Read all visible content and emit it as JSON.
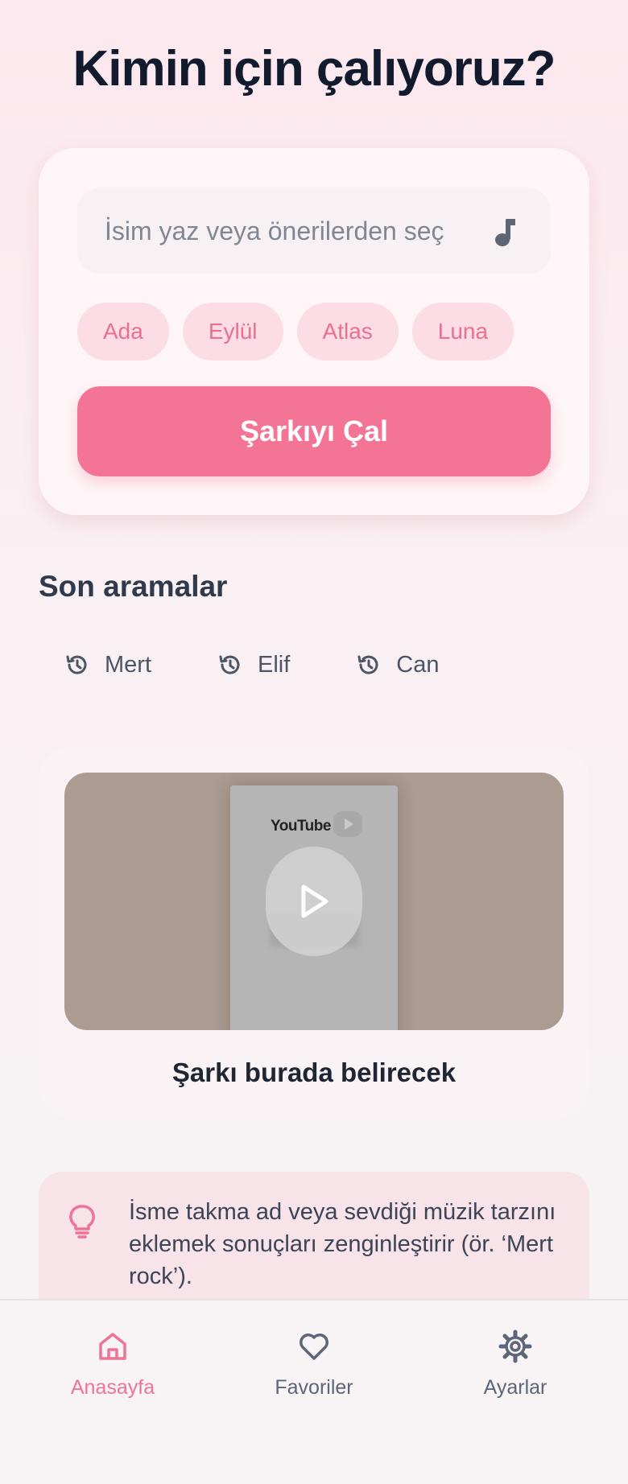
{
  "title": "Kimin için çalıyoruz?",
  "search": {
    "placeholder": "İsim yaz veya önerilerden seç",
    "icon": "music-note-icon"
  },
  "suggestions": [
    "Ada",
    "Eylül",
    "Atlas",
    "Luna"
  ],
  "play_button_label": "Şarkıyı Çal",
  "recent": {
    "title": "Son aramalar",
    "items": [
      "Mert",
      "Elif",
      "Can"
    ],
    "icon": "history-icon"
  },
  "player": {
    "thumbnail_text": "YouTube",
    "caption": "Şarkı burada belirecek"
  },
  "tip": {
    "icon": "lightbulb-icon",
    "text": "İsme takma ad veya sevdiği müzik tarzını eklemek sonuçları zenginleştirir (ör. ‘Mert rock’)."
  },
  "nav": {
    "items": [
      {
        "label": "Anasayfa",
        "icon": "home-icon",
        "active": true
      },
      {
        "label": "Favoriler",
        "icon": "heart-icon",
        "active": false
      },
      {
        "label": "Ayarlar",
        "icon": "gear-icon",
        "active": false
      }
    ]
  },
  "colors": {
    "accent": "#f47495",
    "chip_bg": "#fcdde5",
    "chip_text": "#ea6f90",
    "title": "#121a2e"
  }
}
